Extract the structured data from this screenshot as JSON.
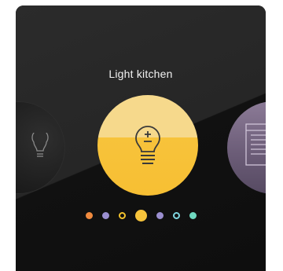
{
  "screen": {
    "title": "Light kitchen",
    "active_index": 3
  },
  "carousel": {
    "center": {
      "icon": "light-bulb-icon",
      "top_color": "#f6d98c",
      "bottom_color": "#f7c33b"
    },
    "left": {
      "icon": "light-bulb-icon",
      "color": "#1c1c1c"
    },
    "right": {
      "icon": "window-blinds-icon",
      "color": "#7a6a86"
    }
  },
  "pager": {
    "dots": [
      {
        "color": "#f08a3e",
        "style": "filled"
      },
      {
        "color": "#9b8fd0",
        "style": "filled"
      },
      {
        "color": "#f3c22d",
        "style": "ring"
      },
      {
        "color": "#f7c33b",
        "style": "filled",
        "active": true
      },
      {
        "color": "#9b8fd0",
        "style": "filled"
      },
      {
        "color": "#7fd6e0",
        "style": "ring"
      },
      {
        "color": "#6fd9c0",
        "style": "filled"
      }
    ]
  }
}
